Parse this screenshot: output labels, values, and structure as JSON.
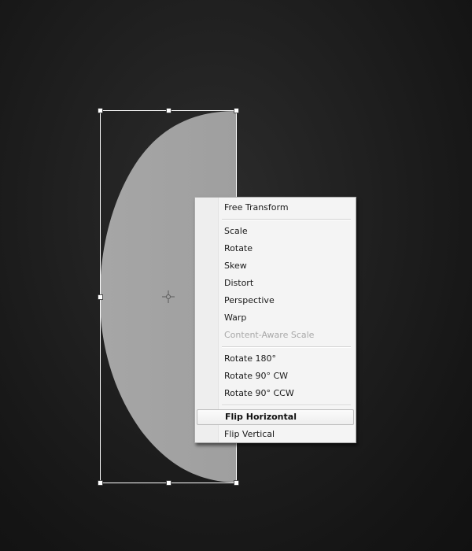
{
  "context_menu": {
    "items": [
      {
        "label": "Free Transform",
        "enabled": true
      },
      {
        "label": "Scale",
        "enabled": true
      },
      {
        "label": "Rotate",
        "enabled": true
      },
      {
        "label": "Skew",
        "enabled": true
      },
      {
        "label": "Distort",
        "enabled": true
      },
      {
        "label": "Perspective",
        "enabled": true
      },
      {
        "label": "Warp",
        "enabled": true
      },
      {
        "label": "Content-Aware Scale",
        "enabled": false
      },
      {
        "label": "Rotate 180°",
        "enabled": true
      },
      {
        "label": "Rotate 90° CW",
        "enabled": true
      },
      {
        "label": "Rotate 90° CCW",
        "enabled": true
      },
      {
        "label": "Flip Horizontal",
        "enabled": true,
        "highlighted": true
      },
      {
        "label": "Flip Vertical",
        "enabled": true
      }
    ]
  },
  "canvas": {
    "shape_color": "#a3a3a3",
    "bounding_box_color": "#ffffff",
    "background_color": "#1b1b1b",
    "center_marker_icon": "crosshair-icon"
  }
}
